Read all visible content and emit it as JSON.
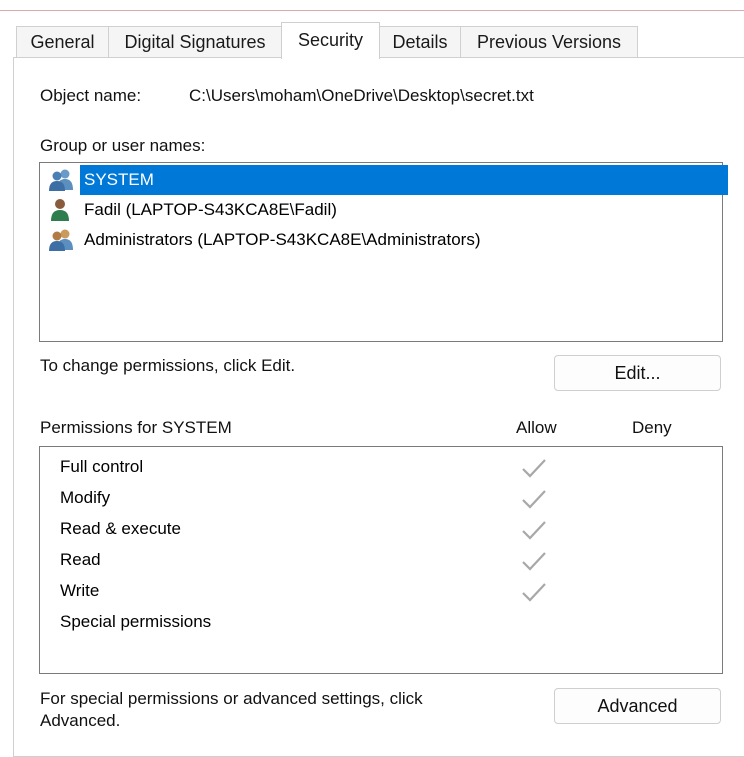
{
  "tabs": [
    {
      "label": "General"
    },
    {
      "label": "Digital Signatures"
    },
    {
      "label": "Security"
    },
    {
      "label": "Details"
    },
    {
      "label": "Previous Versions"
    }
  ],
  "object": {
    "label": "Object name:",
    "value": "C:\\Users\\moham\\OneDrive\\Desktop\\secret.txt"
  },
  "groups": {
    "label": "Group or user names:",
    "items": [
      {
        "name": "SYSTEM",
        "icon": "users-group-icon",
        "selected": true
      },
      {
        "name": "Fadil (LAPTOP-S43KCA8E\\Fadil)",
        "icon": "user-icon",
        "selected": false
      },
      {
        "name": "Administrators (LAPTOP-S43KCA8E\\Administrators)",
        "icon": "admin-group-icon",
        "selected": false
      }
    ]
  },
  "change_text": "To change permissions, click Edit.",
  "edit_label": "Edit...",
  "permissions": {
    "label": "Permissions for SYSTEM",
    "allow_header": "Allow",
    "deny_header": "Deny",
    "rows": [
      {
        "name": "Full control",
        "allow": true,
        "deny": false
      },
      {
        "name": "Modify",
        "allow": true,
        "deny": false
      },
      {
        "name": "Read & execute",
        "allow": true,
        "deny": false
      },
      {
        "name": "Read",
        "allow": true,
        "deny": false
      },
      {
        "name": "Write",
        "allow": true,
        "deny": false
      },
      {
        "name": "Special permissions",
        "allow": false,
        "deny": false
      }
    ]
  },
  "advanced_text_line1": "For special permissions or advanced settings, click",
  "advanced_text_line2": "Advanced.",
  "advanced_label": "Advanced",
  "colors": {
    "selection": "#0078d7",
    "check": "#a8a8a8"
  }
}
